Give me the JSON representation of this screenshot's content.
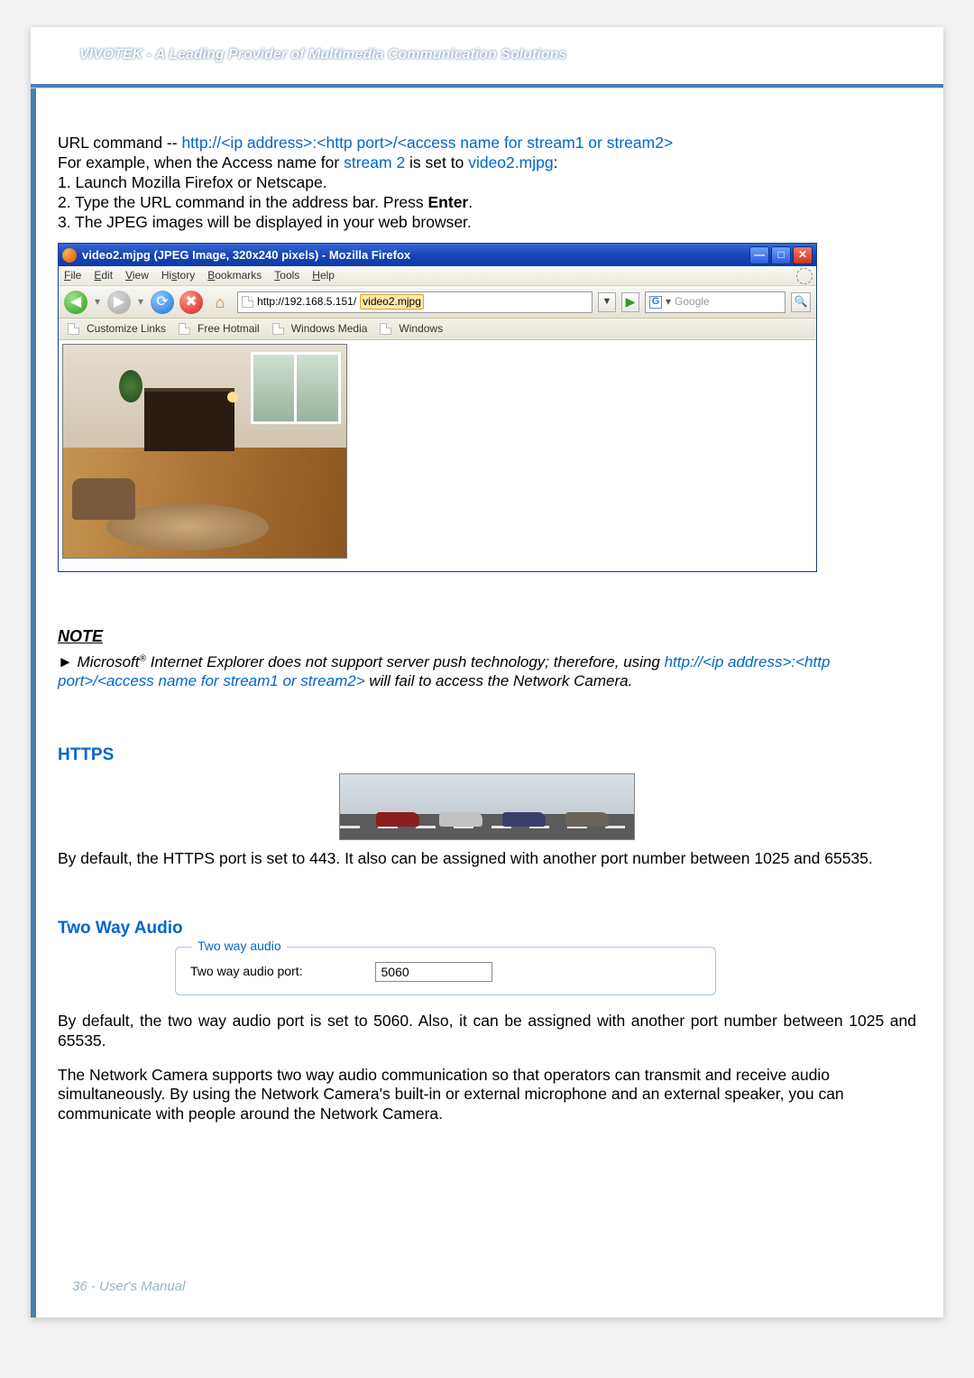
{
  "header": {
    "title": "VIVOTEK - A Leading Provider of Multimedia Communication Solutions"
  },
  "intro": {
    "url_cmd_prefix": "URL command -- ",
    "url_cmd_link": "http://<ip address>:<http port>/<access name for stream1 or stream2>",
    "example_prefix": "For example, when the Access name for ",
    "stream2": "stream 2",
    "example_mid": " is set to ",
    "video2": "video2.mjpg",
    "example_suffix": ":",
    "step1": "1. Launch Mozilla Firefox or Netscape.",
    "step2a": "2. Type the URL command in the address bar. Press ",
    "step2b": "Enter",
    "step2c": ".",
    "step3": "3. The JPEG images will be displayed in your web browser."
  },
  "firefox": {
    "title": "video2.mjpg (JPEG Image, 320x240 pixels) - Mozilla Firefox",
    "menu": {
      "file": "File",
      "edit": "Edit",
      "view": "View",
      "history": "History",
      "bookmarks": "Bookmarks",
      "tools": "Tools",
      "help": "Help"
    },
    "url_plain": "http://192.168.5.151/",
    "url_highlight": "video2.mjpg",
    "search_placeholder": "Google",
    "bookmarks": {
      "b1": "Customize Links",
      "b2": "Free Hotmail",
      "b3": "Windows Media",
      "b4": "Windows"
    }
  },
  "note": {
    "heading": "NOTE",
    "arrow": "►",
    "body1a": " Microsoft",
    "body1b": " Internet Explorer does not support server push technology; therefore, using ",
    "link1": "http://<ip address>:<http port>/<access name for stream1 or stream2>",
    "body1c": " will fail to access the Network Camera."
  },
  "https": {
    "heading": "HTTPS",
    "body": "By default, the HTTPS port is set to 443. It also can be assigned with another port number between 1025 and 65535."
  },
  "twa": {
    "heading": "Two Way Audio",
    "legend": "Two way audio",
    "label": "Two way audio port:",
    "value": "5060",
    "p1": "By default, the two way audio port is set to 5060. Also, it can be assigned with another port number between 1025 and 65535.",
    "p2": "The Network Camera supports two way audio communication so that operators can transmit and receive audio simultaneously. By using the Network Camera's built-in or external microphone and an external speaker, you can communicate with people around the Network Camera."
  },
  "footer": "36 - User's Manual"
}
